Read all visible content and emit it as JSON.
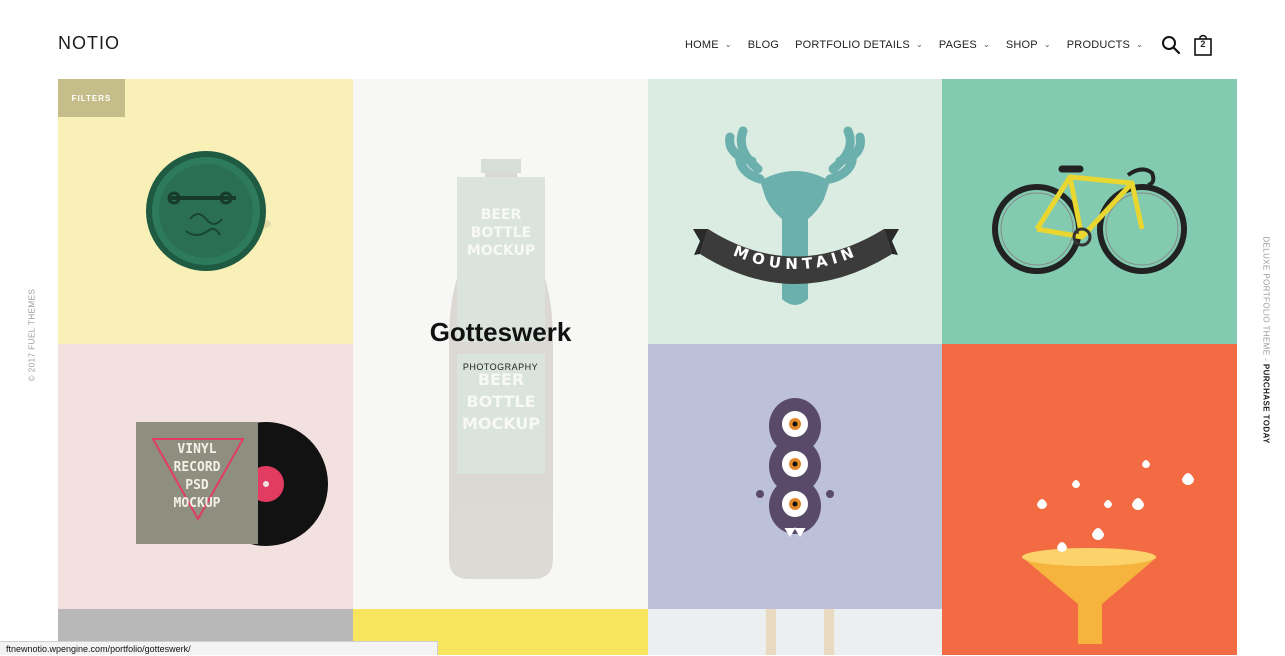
{
  "header": {
    "logo": "NOTIO",
    "nav": [
      {
        "label": "HOME",
        "dropdown": true
      },
      {
        "label": "BLOG",
        "dropdown": false
      },
      {
        "label": "PORTFOLIO DETAILS",
        "dropdown": true
      },
      {
        "label": "PAGES",
        "dropdown": true
      },
      {
        "label": "SHOP",
        "dropdown": true
      },
      {
        "label": "PRODUCTS",
        "dropdown": true
      }
    ],
    "cart_count": "2"
  },
  "side": {
    "left_text": "© 2017 FUEL THEMES",
    "right_text": "DELUXE PORTFOLIO THEME - ",
    "right_link": "PURCHASE TODAY"
  },
  "filters_label": "FILTERS",
  "featured": {
    "title": "Gotteswerk",
    "category": "PHOTOGRAPHY",
    "bottle_lines": [
      "BEER",
      "BOTTLE",
      "MOCKUP"
    ]
  },
  "tiles": {
    "mountain_text": "MOUNTAIN",
    "vinyl_lines": [
      "VINYL",
      "RECORD",
      "PSD",
      "MOCKUP"
    ]
  },
  "status_bar": {
    "url": "ftnewnotio.wpengine.com/portfolio/gotteswerk/"
  },
  "colors": {
    "tile_yellow": "#f8f0b6",
    "tile_white": "#f7f7f6",
    "tile_mint": "#dbece3",
    "tile_green": "#82cbb0",
    "tile_pink": "#f2e1de",
    "tile_lavender": "#bcc1d9",
    "tile_orange": "#f26b43",
    "filters_bg": "#c5be8a"
  }
}
